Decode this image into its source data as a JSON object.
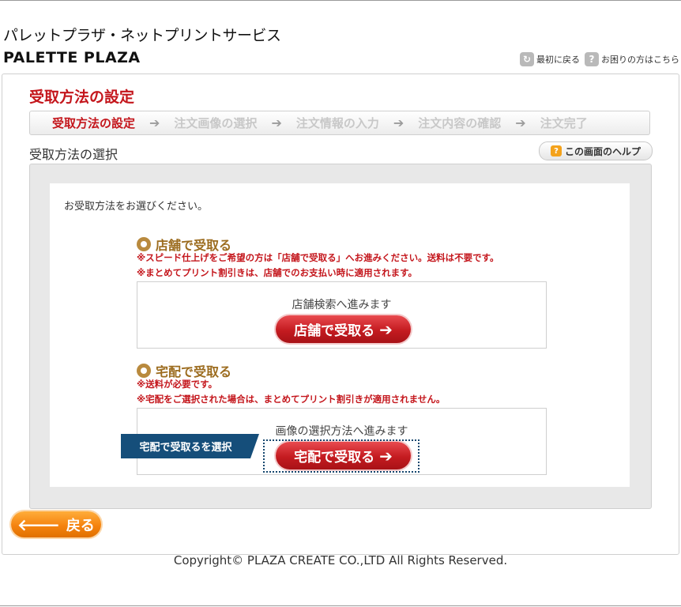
{
  "header": {
    "site_name": "パレットプラザ・ネットプリントサービス",
    "logo": "PALETTE PLAZA",
    "links": [
      {
        "label": "最初に戻る",
        "icon": "return-icon"
      },
      {
        "label": "お困りの方はこちら",
        "icon": "question-icon"
      }
    ]
  },
  "page": {
    "title": "受取方法の設定",
    "steps": [
      {
        "label": "受取方法の設定",
        "active": true
      },
      {
        "label": "注文画像の選択",
        "active": false
      },
      {
        "label": "注文情報の入力",
        "active": false
      },
      {
        "label": "注文内容の確認",
        "active": false
      },
      {
        "label": "注文完了",
        "active": false
      }
    ],
    "section_title": "受取方法の選択",
    "help_label": "この画面のヘルプ",
    "instruction": "お受取方法をお選びください。"
  },
  "options": [
    {
      "title": "店舗で受取る",
      "notes": [
        "※スピード仕上げをご希望の方は「店舗で受取る」へお進みください。送料は不要です。",
        "※まとめてプリント割引きは、店舗でのお支払い時に適用されます。"
      ],
      "box_text": "店舗検索へ進みます",
      "button_label": "店舗で受取る"
    },
    {
      "title": "宅配で受取る",
      "notes": [
        "※送料が必要です。",
        "※宅配をご選択された場合は、まとめてプリント割引きが適用されません。"
      ],
      "box_text": "画像の選択方法へ進みます",
      "button_label": "宅配で受取る"
    }
  ],
  "tooltip": "宅配で受取るを選択",
  "back_label": "戻る",
  "footer": "Copyright© PLAZA CREATE CO.,LTD All Rights Reserved.",
  "colors": {
    "accent_red": "#c4161c",
    "option_gold": "#9c6c1f",
    "tooltip_blue": "#154e7a",
    "back_orange": "#f5830f"
  }
}
